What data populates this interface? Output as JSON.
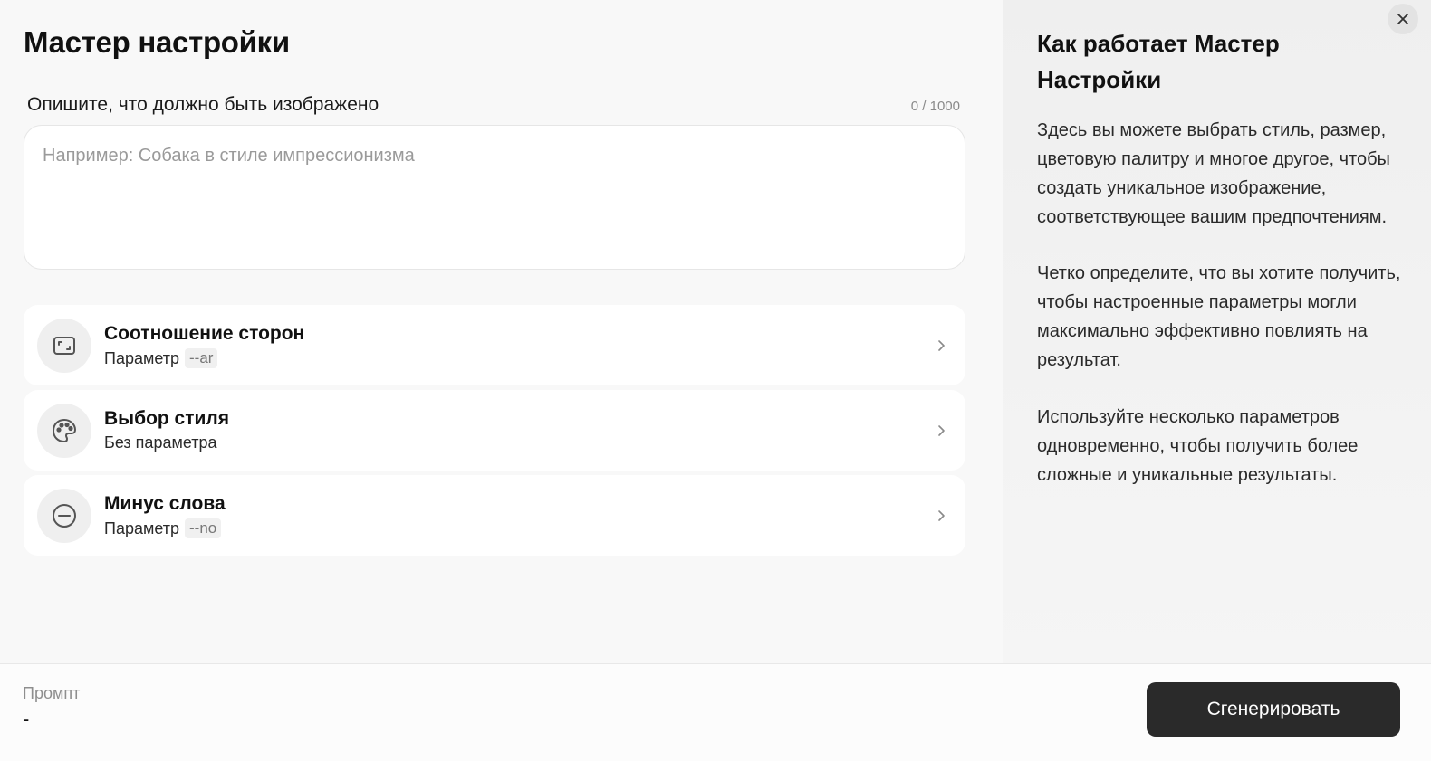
{
  "wizard": {
    "title": "Мастер настройки",
    "description_label": "Опишите, что должно быть изображено",
    "counter": "0 / 1000",
    "textarea_placeholder": "Например: Собака в стиле импрессионизма",
    "textarea_value": ""
  },
  "options": [
    {
      "title": "Соотношение сторон",
      "sub": "Параметр",
      "tag": "--ar",
      "icon": "aspect-ratio-icon"
    },
    {
      "title": "Выбор стиля",
      "sub": "Без параметра",
      "tag": "",
      "icon": "palette-icon"
    },
    {
      "title": "Минус слова",
      "sub": "Параметр",
      "tag": "--no",
      "icon": "minus-circle-icon"
    }
  ],
  "info": {
    "title": "Как работает Мастер Настройки",
    "paragraphs": [
      "Здесь вы можете выбрать стиль, размер, цветовую палитру и многое другое, чтобы создать уникальное изображение, соответствующее вашим предпочтениям.",
      "Четко определите, что вы хотите получить, чтобы настроенные параметры могли максимально эффективно повлиять на результат.",
      "Используйте несколько параметров одновременно, чтобы получить более сложные и уникальные результаты."
    ]
  },
  "footer": {
    "prompt_label": "Промпт",
    "prompt_value": "-",
    "generate_label": "Сгенерировать"
  },
  "colors": {
    "button_bg": "#2a2a2a",
    "panel_bg": "#f8f8f8",
    "info_bg": "#efefef"
  }
}
